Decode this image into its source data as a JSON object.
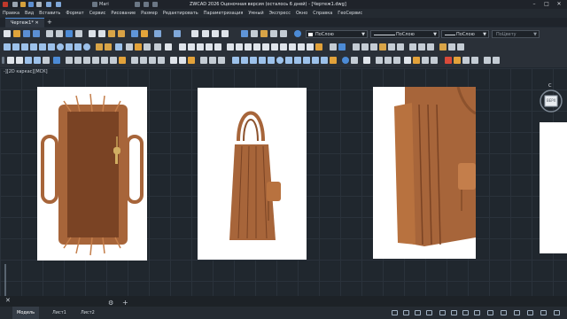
{
  "titlebar": {
    "file_name": "Mari",
    "title": "ZWCAD 2026 Оценочная версия (осталось 6 дней) - [Чертеж1.dwg]"
  },
  "menu": [
    "Правка",
    "Вид",
    "Вставить",
    "Формат",
    "Сервис",
    "Рисование",
    "Размер",
    "Редактировать",
    "Параметризация",
    "Умный",
    "Экспресс",
    "Окно",
    "Справка",
    "ГеоСервис"
  ],
  "properties": {
    "color": "ПоСлою",
    "linetype": "ПоСлою",
    "lineweight": "ПоСлою",
    "plotstyle": "ПоЦвету"
  },
  "document_tab": "Чертеж1*",
  "add_tab": "+",
  "viewport_label": "-][2D каркас][МСК]",
  "viewcube": {
    "north": "С",
    "top": "ВЕРХ"
  },
  "command_prompt": "",
  "layouts": {
    "model": "Модель",
    "sheet1": "Лист1",
    "sheet2": "Лист2"
  },
  "colors": {
    "accent": "#4c8bd6",
    "background": "#20272e",
    "leather": "#a7653a"
  }
}
